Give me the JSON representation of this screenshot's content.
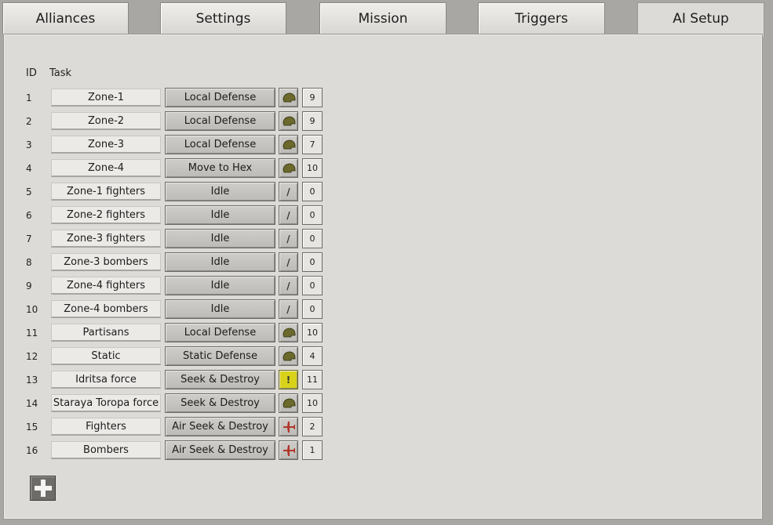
{
  "tabs": [
    {
      "label": "Alliances",
      "active": false
    },
    {
      "label": "Settings",
      "active": false
    },
    {
      "label": "Mission",
      "active": false
    },
    {
      "label": "Triggers",
      "active": false
    },
    {
      "label": "AI Setup",
      "active": true
    }
  ],
  "table": {
    "col_id": "ID",
    "col_task": "Task",
    "rows": [
      {
        "id": "1",
        "name": "Zone-1",
        "task": "Local Defense",
        "icon": "helmet-icon",
        "count": "9"
      },
      {
        "id": "2",
        "name": "Zone-2",
        "task": "Local Defense",
        "icon": "helmet-icon",
        "count": "9"
      },
      {
        "id": "3",
        "name": "Zone-3",
        "task": "Local Defense",
        "icon": "helmet-icon",
        "count": "7"
      },
      {
        "id": "4",
        "name": "Zone-4",
        "task": "Move to Hex",
        "icon": "helmet-icon",
        "count": "10"
      },
      {
        "id": "5",
        "name": "Zone-1 fighters",
        "task": "Idle",
        "icon": "slash-icon",
        "count": "0"
      },
      {
        "id": "6",
        "name": "Zone-2 fighters",
        "task": "Idle",
        "icon": "slash-icon",
        "count": "0"
      },
      {
        "id": "7",
        "name": "Zone-3 fighters",
        "task": "Idle",
        "icon": "slash-icon",
        "count": "0"
      },
      {
        "id": "8",
        "name": "Zone-3 bombers",
        "task": "Idle",
        "icon": "slash-icon",
        "count": "0"
      },
      {
        "id": "9",
        "name": "Zone-4 fighters",
        "task": "Idle",
        "icon": "slash-icon",
        "count": "0"
      },
      {
        "id": "10",
        "name": "Zone-4 bombers",
        "task": "Idle",
        "icon": "slash-icon",
        "count": "0"
      },
      {
        "id": "11",
        "name": "Partisans",
        "task": "Local Defense",
        "icon": "helmet-icon",
        "count": "10"
      },
      {
        "id": "12",
        "name": "Static",
        "task": "Static Defense",
        "icon": "helmet-icon",
        "count": "4"
      },
      {
        "id": "13",
        "name": "Idritsa force",
        "task": "Seek & Destroy",
        "icon": "warning-icon",
        "count": "11"
      },
      {
        "id": "14",
        "name": "Staraya Toropa force",
        "task": "Seek & Destroy",
        "icon": "helmet-icon",
        "count": "10"
      },
      {
        "id": "15",
        "name": "Fighters",
        "task": "Air Seek & Destroy",
        "icon": "plane-icon",
        "count": "2"
      },
      {
        "id": "16",
        "name": "Bombers",
        "task": "Air Seek & Destroy",
        "icon": "plane-icon",
        "count": "1"
      }
    ]
  },
  "glyphs": {
    "slash": "/",
    "warning": "!"
  },
  "colors": {
    "helmet": "#6b6a2c",
    "plane": "#b0382a",
    "warning_bg": "#d8d21a"
  }
}
